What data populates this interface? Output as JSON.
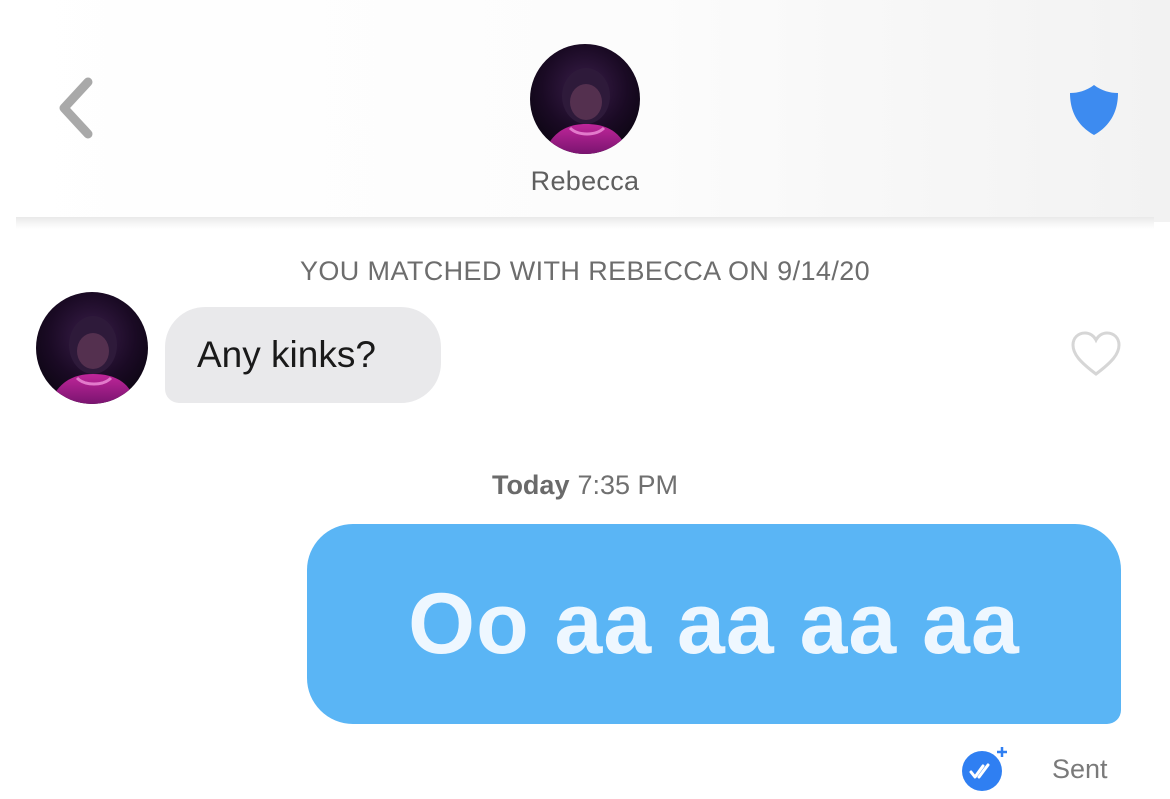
{
  "header": {
    "contact_name": "Rebecca",
    "back_icon": "chevron-left-icon",
    "safety_icon": "shield-icon"
  },
  "match_notice": "YOU MATCHED WITH REBECCA ON 9/14/20",
  "messages": [
    {
      "direction": "incoming",
      "text": "Any kinks?"
    },
    {
      "direction": "outgoing",
      "text": "Oo aa aa aa aa"
    }
  ],
  "timestamp": {
    "day": "Today",
    "time": "7:35 PM"
  },
  "status": {
    "label": "Sent",
    "icon": "read-receipt-icon"
  },
  "colors": {
    "outgoing_bubble": "#5ab5f5",
    "incoming_bubble": "#e9e9eb",
    "shield": "#3d8bf0",
    "receipt": "#2f7ff2"
  }
}
